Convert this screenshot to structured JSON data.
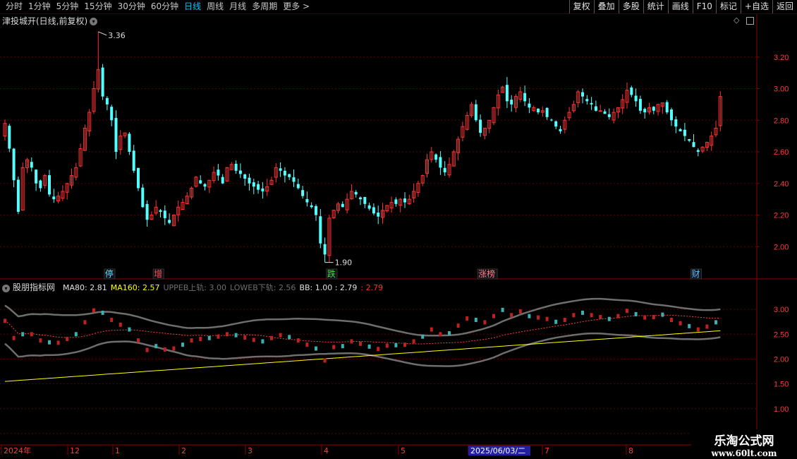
{
  "toolbar": {
    "periods": [
      "分时",
      "1分钟",
      "5分钟",
      "15分钟",
      "30分钟",
      "60分钟",
      "日线",
      "周线",
      "月线",
      "多周期",
      "更多 >"
    ],
    "active": "日线",
    "tools": [
      "复权",
      "叠加",
      "多股",
      "统计",
      "画线",
      "F10",
      "标记",
      "+自选",
      "返回"
    ]
  },
  "stock": {
    "title": "津投城开(日线,前复权)"
  },
  "indicator": {
    "name": "股朋指标网",
    "items": [
      {
        "label": "MA80: 2.81",
        "color": "#e0e0e0"
      },
      {
        "label": "MA160: 2.57",
        "color": "#ffff00"
      },
      {
        "label": "UPPEB上轨: 3.00",
        "color": "#6e6e6e"
      },
      {
        "label": "LOWEB下轨: 2.56",
        "color": "#6e6e6e"
      },
      {
        "label": "BB: 1.00 : 2.79",
        "color": "#e0e0e0"
      },
      {
        "label": ": 2.79",
        "color": "#ff3030"
      }
    ]
  },
  "chart_data": [
    {
      "type": "candlestick",
      "title": "津投城开(日线,前复权)",
      "ylim": [
        1.8,
        3.4
      ],
      "yticks": [
        "3.20",
        "3.00",
        "2.80",
        "2.60",
        "2.40",
        "2.20",
        "2.00"
      ],
      "high_label": "3.36",
      "low_label": "1.90",
      "closes": [
        2.78,
        2.62,
        2.42,
        2.22,
        2.5,
        2.55,
        2.5,
        2.4,
        2.37,
        2.45,
        2.33,
        2.3,
        2.32,
        2.35,
        2.4,
        2.45,
        2.5,
        2.62,
        2.75,
        2.85,
        3.0,
        3.12,
        2.95,
        2.9,
        2.8,
        2.6,
        2.7,
        2.72,
        2.6,
        2.48,
        2.37,
        2.25,
        2.17,
        2.2,
        2.25,
        2.22,
        2.18,
        2.15,
        2.2,
        2.25,
        2.28,
        2.32,
        2.37,
        2.44,
        2.4,
        2.38,
        2.42,
        2.47,
        2.45,
        2.4,
        2.5,
        2.52,
        2.48,
        2.46,
        2.43,
        2.4,
        2.38,
        2.36,
        2.35,
        2.38,
        2.42,
        2.5,
        2.48,
        2.45,
        2.44,
        2.41,
        2.37,
        2.32,
        2.28,
        2.25,
        2.2,
        2.02,
        1.95,
        2.18,
        2.23,
        2.27,
        2.25,
        2.3,
        2.35,
        2.33,
        2.3,
        2.27,
        2.24,
        2.21,
        2.19,
        2.23,
        2.26,
        2.28,
        2.27,
        2.3,
        2.28,
        2.3,
        2.35,
        2.4,
        2.45,
        2.55,
        2.6,
        2.55,
        2.5,
        2.47,
        2.52,
        2.6,
        2.68,
        2.76,
        2.83,
        2.9,
        2.8,
        2.72,
        2.75,
        2.8,
        2.88,
        2.96,
        3.01,
        2.92,
        2.9,
        2.95,
        2.98,
        2.92,
        2.88,
        2.88,
        2.85,
        2.86,
        2.82,
        2.8,
        2.76,
        2.73,
        2.8,
        2.85,
        2.9,
        2.98,
        2.95,
        2.92,
        2.9,
        2.86,
        2.86,
        2.84,
        2.82,
        2.85,
        2.88,
        2.93,
        2.99,
        2.96,
        2.92,
        2.86,
        2.85,
        2.88,
        2.86,
        2.9,
        2.91,
        2.85,
        2.8,
        2.76,
        2.73,
        2.7,
        2.67,
        2.63,
        2.6,
        2.63,
        2.66,
        2.7,
        2.75,
        2.95
      ],
      "markers": [
        {
          "label": "停",
          "color": "#60e0ff"
        },
        {
          "label": "增",
          "color": "#ff5050"
        },
        {
          "label": "跌",
          "color": "#40e040"
        },
        {
          "label": "涨榜",
          "color": "#ff8080"
        },
        {
          "label": "财",
          "color": "#60c0ff"
        }
      ]
    },
    {
      "type": "line",
      "title": "股朋指标网",
      "ylim": [
        0.3,
        3.4
      ],
      "yticks": [
        "3.00",
        "2.50",
        "2.00",
        "1.50",
        "1.00",
        "0.50"
      ],
      "series": [
        {
          "name": "MA80",
          "last": 2.81
        },
        {
          "name": "MA160",
          "last": 2.57
        },
        {
          "name": "UPPEB上轨",
          "last": 3.0
        },
        {
          "name": "LOWEB下轨",
          "last": 2.56
        },
        {
          "name": "BB",
          "last": 2.79
        }
      ]
    }
  ],
  "time_axis": {
    "labels": [
      "2024年",
      "12",
      "1",
      "2",
      "3",
      "4",
      "5",
      "2025/06/03/二",
      "7",
      "8"
    ]
  },
  "logo": {
    "line1": "乐淘公式网",
    "line2": "www.60lt.com"
  },
  "colors": {
    "up": "#ff3333",
    "down": "#54ffff",
    "axis": "#8b0000",
    "ma160": "#ffff00",
    "band": "#6e6e6e"
  }
}
